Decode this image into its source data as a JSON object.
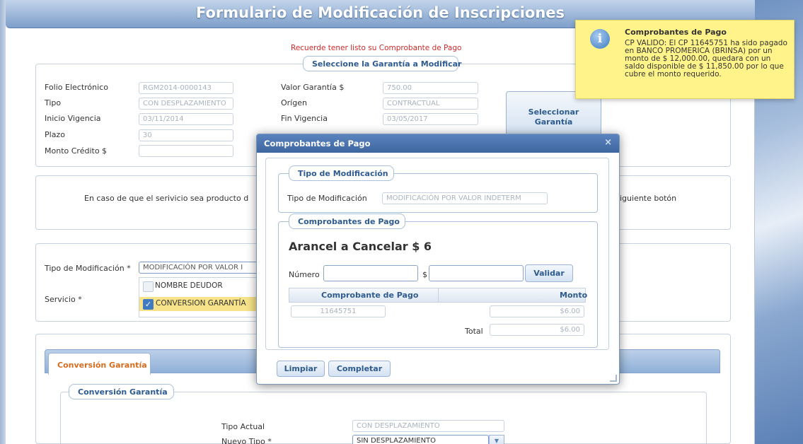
{
  "page": {
    "title": "Formulario de Modificación de Inscripciones",
    "payment_reminder": "Recuerde tener listo su Comprobante de Pago"
  },
  "garantia": {
    "legend": "Seleccione la Garantía a Modificar",
    "folio_label": "Folio Electrónico",
    "folio_value": "RGM2014-0000143",
    "tipo_label": "Tipo",
    "tipo_value": "CON DESPLAZAMIENTO",
    "inicio_label": "Inicio Vigencia",
    "inicio_value": "03/11/2014",
    "plazo_label": "Plazo",
    "plazo_value": "30",
    "monto_credito_label": "Monto Crédito $",
    "monto_credito_value": "",
    "valor_label": "Valor Garantía $",
    "valor_value": "750.00",
    "origen_label": "Orígen",
    "origen_value": "CONTRACTUAL",
    "fin_label": "Fin Vigencia",
    "fin_value": "03/05/2017",
    "select_button": "Seleccionar Garantía"
  },
  "service_note": {
    "text_left": "En caso de que el serivicio sea producto d",
    "text_right": "iguiente botón"
  },
  "modification": {
    "tipo_label": "Tipo de Modificación",
    "tipo_required": "*",
    "tipo_value": "MODIFICACIÓN POR VALOR I",
    "servicio_label": "Servicio",
    "servicio_required": "*",
    "options": [
      {
        "label": "NOMBRE DEUDOR",
        "checked": false
      },
      {
        "label": "CONVERSION GARANTÍA",
        "checked": true
      }
    ]
  },
  "conversion": {
    "tab": "Conversión Garantía",
    "legend": "Conversión Garantía",
    "tipo_actual_label": "Tipo Actual",
    "tipo_actual_value": "CON DESPLAZAMIENTO",
    "nuevo_tipo_label": "Nuevo Tipo",
    "nuevo_tipo_required": "*",
    "nuevo_tipo_value": "SIN DESPLAZAMIENTO"
  },
  "notification": {
    "title": "Comprobantes de Pago",
    "message": "CP VALIDO: El CP 11645751 ha sido pagado en BANCO PROMERICA (BRINSA) por un monto de $ 12,000.00, quedara con un saldo disponible de $ 11,850.00 por lo que cubre el monto requerido."
  },
  "modal": {
    "title": "Comprobantes de Pago",
    "close": "×",
    "tipo_legend": "Tipo de Modificación",
    "tipo_label": "Tipo de Modificación",
    "tipo_value": "MODIFICACIÓN POR VALOR INDETERM",
    "comprobantes_legend": "Comprobantes de Pago",
    "arancel": "Arancel a Cancelar $ 6",
    "numero_label": "Número",
    "numero_value": "",
    "dollar_label": "$",
    "amount_value": "",
    "validar": "Validar",
    "table": {
      "columns": [
        "Comprobante de Pago",
        "Monto"
      ],
      "rows": [
        {
          "comprobante": "11645751",
          "monto": "$6.00"
        }
      ]
    },
    "total_label": "Total",
    "total_value": "$6.00",
    "limpiar": "Limpiar",
    "completar": "Completar"
  }
}
